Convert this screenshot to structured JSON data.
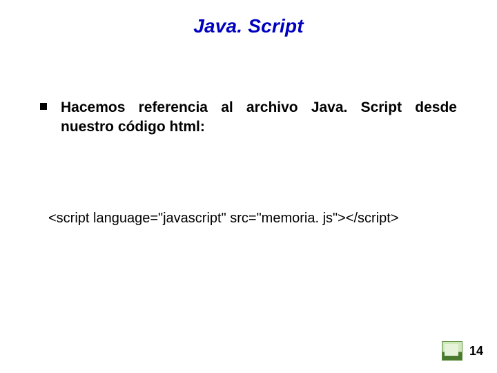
{
  "title": "Java. Script",
  "bullet": "Hacemos referencia al archivo Java. Script desde nuestro código html:",
  "code": "<script language=\"javascript\" src=\"memoria. js\"></script>",
  "page_number": "14"
}
